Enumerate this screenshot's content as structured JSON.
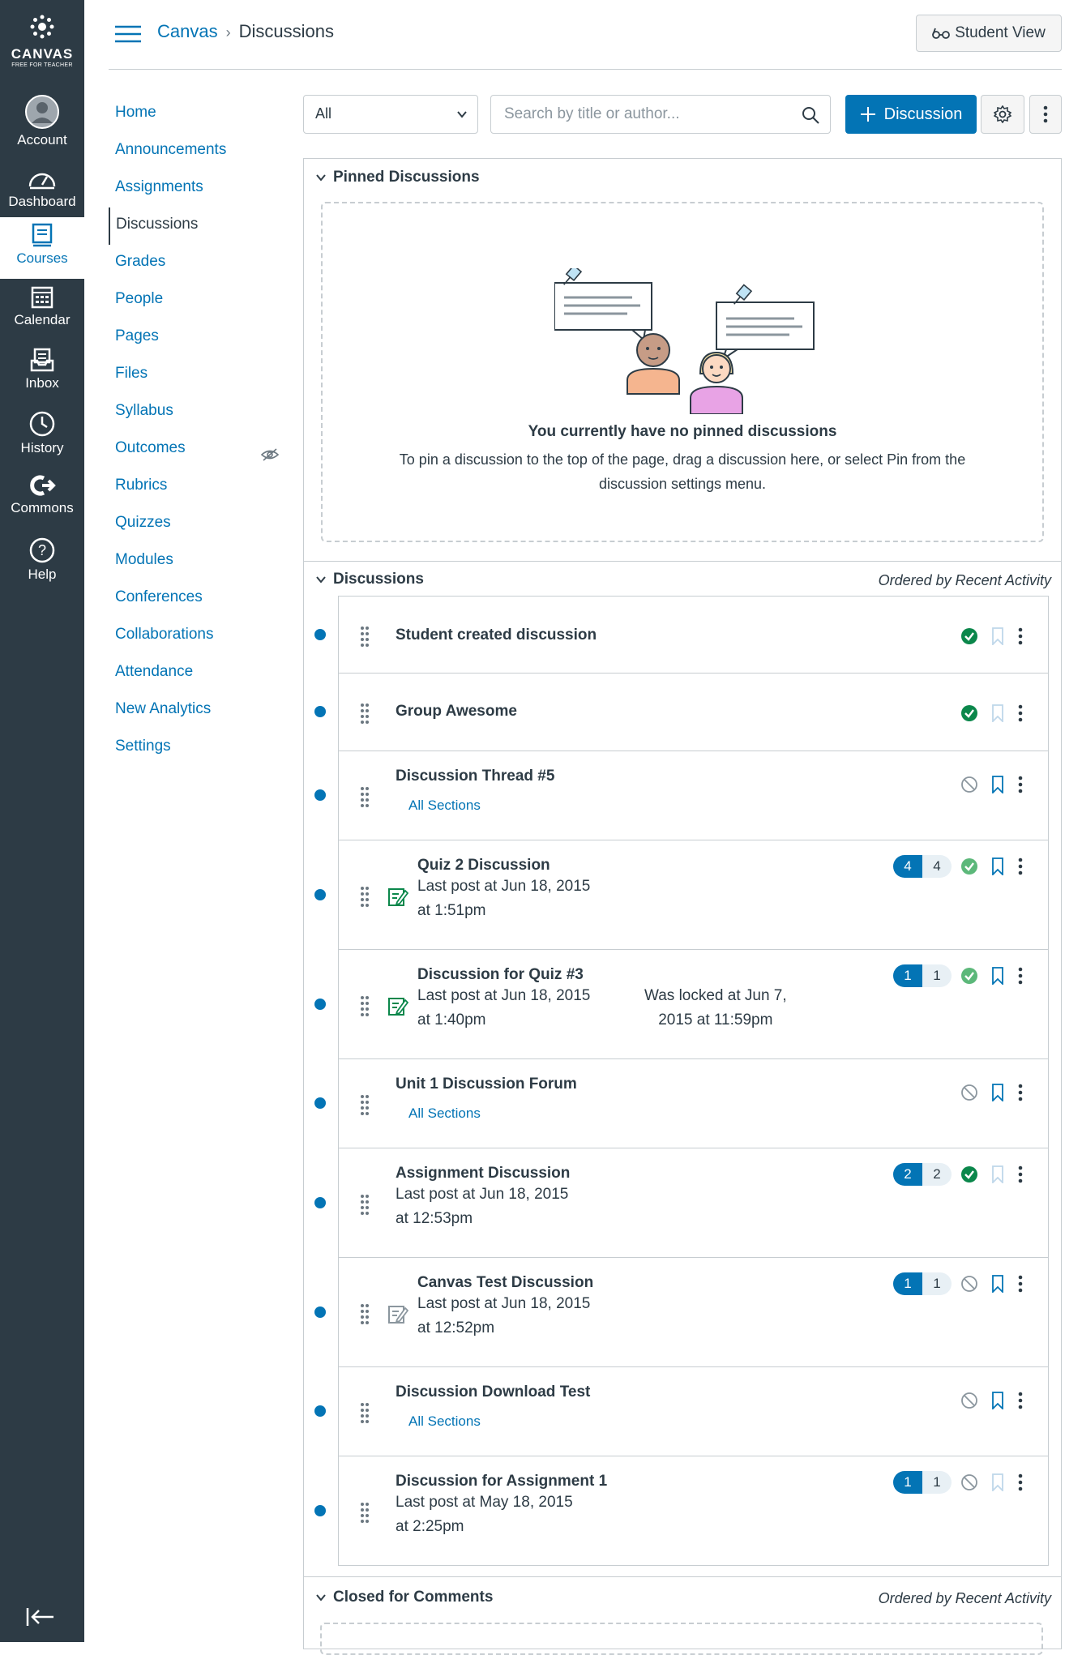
{
  "global_nav": {
    "logo_title": "CANVAS",
    "logo_subtitle": "FREE FOR TEACHER",
    "items": [
      {
        "label": "Account",
        "icon": "avatar-icon"
      },
      {
        "label": "Dashboard",
        "icon": "dashboard-icon"
      },
      {
        "label": "Courses",
        "icon": "courses-icon"
      },
      {
        "label": "Calendar",
        "icon": "calendar-icon"
      },
      {
        "label": "Inbox",
        "icon": "inbox-icon"
      },
      {
        "label": "History",
        "icon": "history-icon"
      },
      {
        "label": "Commons",
        "icon": "commons-icon"
      },
      {
        "label": "Help",
        "icon": "help-icon"
      }
    ],
    "active": "Courses"
  },
  "header": {
    "breadcrumb_root": "Canvas",
    "breadcrumb_current": "Discussions",
    "student_view": "Student View"
  },
  "course_nav": [
    "Home",
    "Announcements",
    "Assignments",
    "Discussions",
    "Grades",
    "People",
    "Pages",
    "Files",
    "Syllabus",
    "Outcomes",
    "Rubrics",
    "Quizzes",
    "Modules",
    "Conferences",
    "Collaborations",
    "Attendance",
    "New Analytics",
    "Settings"
  ],
  "toolbar": {
    "filter_value": "All",
    "search_placeholder": "Search by title or author...",
    "add_label": "Discussion"
  },
  "pinned": {
    "heading": "Pinned Discussions",
    "empty_title": "You currently have no pinned discussions",
    "empty_desc": "To pin a discussion to the top of the page, drag a discussion here, or select Pin from the discussion settings menu."
  },
  "discussions": {
    "heading": "Discussions",
    "order": "Ordered by Recent Activity",
    "items": [
      {
        "title": "Student created discussion"
      },
      {
        "title": "Group Awesome"
      },
      {
        "title": "Discussion Thread #5",
        "section": "All Sections"
      },
      {
        "title": "Quiz 2 Discussion",
        "last_post_1": "Last post at Jun 18, 2015",
        "last_post_2": "at 1:51pm",
        "unread": "4",
        "total": "4"
      },
      {
        "title": "Discussion for Quiz #3",
        "last_post_1": "Last post at Jun 18, 2015",
        "last_post_2": "at 1:40pm",
        "lock_1": "Was locked at Jun 7,",
        "lock_2": "2015 at 11:59pm",
        "unread": "1",
        "total": "1"
      },
      {
        "title": "Unit 1 Discussion Forum",
        "section": "All Sections"
      },
      {
        "title": "Assignment Discussion",
        "last_post_1": "Last post at Jun 18, 2015",
        "last_post_2": "at 12:53pm",
        "unread": "2",
        "total": "2"
      },
      {
        "title": "Canvas Test Discussion",
        "last_post_1": "Last post at Jun 18, 2015",
        "last_post_2": "at 12:52pm",
        "unread": "1",
        "total": "1"
      },
      {
        "title": "Discussion Download Test",
        "section": "All Sections"
      },
      {
        "title": "Discussion for Assignment 1",
        "last_post_1": "Last post at May 18, 2015",
        "last_post_2": "at 2:25pm",
        "unread": "1",
        "total": "1"
      }
    ]
  },
  "closed": {
    "heading": "Closed for Comments",
    "order": "Ordered by Recent Activity"
  },
  "colors": {
    "brand": "#0374b5",
    "nav_bg": "#2d3b45",
    "success": "#0b874b"
  }
}
